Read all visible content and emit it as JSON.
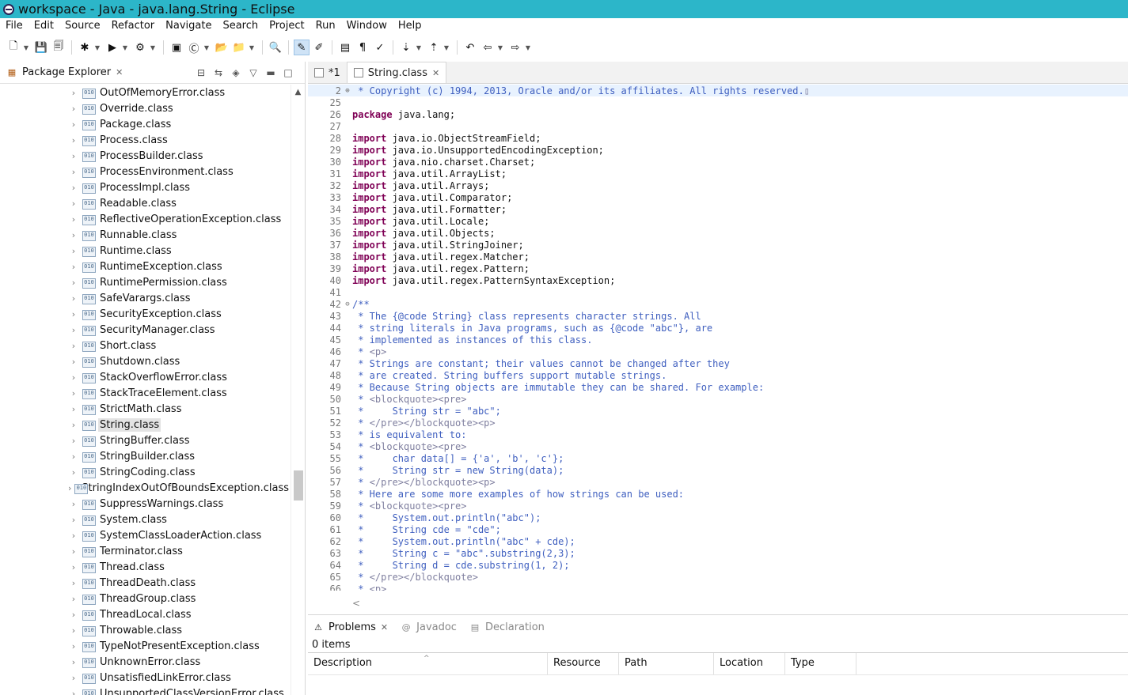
{
  "window": {
    "title": "workspace - Java - java.lang.String - Eclipse"
  },
  "menu": [
    "File",
    "Edit",
    "Source",
    "Refactor",
    "Navigate",
    "Search",
    "Project",
    "Run",
    "Window",
    "Help"
  ],
  "toolbar_icons": [
    "new-icon",
    "save-icon",
    "save-all-icon",
    "debug-icon",
    "run-icon",
    "external-tools-icon",
    "new-java-project-icon",
    "new-class-icon",
    "open-type-icon",
    "open-task-icon",
    "search-icon",
    "toggle-mark-occurrences-icon",
    "toggle-highlight-icon",
    "toggle-breadcrumb-icon",
    "show-whitespace-icon",
    "pin-icon",
    "next-annotation-icon",
    "previous-annotation-icon",
    "last-edit-location-icon",
    "back-icon",
    "forward-icon"
  ],
  "package_explorer": {
    "title": "Package Explorer",
    "selected": "String.class",
    "items": [
      "OutOfMemoryError.class",
      "Override.class",
      "Package.class",
      "Process.class",
      "ProcessBuilder.class",
      "ProcessEnvironment.class",
      "ProcessImpl.class",
      "Readable.class",
      "ReflectiveOperationException.class",
      "Runnable.class",
      "Runtime.class",
      "RuntimeException.class",
      "RuntimePermission.class",
      "SafeVarargs.class",
      "SecurityException.class",
      "SecurityManager.class",
      "Short.class",
      "Shutdown.class",
      "StackOverflowError.class",
      "StackTraceElement.class",
      "StrictMath.class",
      "String.class",
      "StringBuffer.class",
      "StringBuilder.class",
      "StringCoding.class",
      "StringIndexOutOfBoundsException.class",
      "SuppressWarnings.class",
      "System.class",
      "SystemClassLoaderAction.class",
      "Terminator.class",
      "Thread.class",
      "ThreadDeath.class",
      "ThreadGroup.class",
      "ThreadLocal.class",
      "Throwable.class",
      "TypeNotPresentException.class",
      "UnknownError.class",
      "UnsatisfiedLinkError.class",
      "UnsupportedClassVersionError.class"
    ]
  },
  "editor": {
    "tabs": [
      {
        "label": "*1"
      },
      {
        "label": "String.class"
      }
    ],
    "lines": [
      {
        "n": "2",
        "fold": "⊕",
        "segs": [
          {
            "t": " * Copyright (c) 1994, 2013, Oracle and/or its affiliates. All rights reserved.",
            "c": "c"
          },
          {
            "t": "▯",
            "c": "h"
          }
        ]
      },
      {
        "n": "25",
        "segs": []
      },
      {
        "n": "26",
        "segs": [
          {
            "t": "package",
            "c": "k"
          },
          {
            "t": " java.lang;"
          }
        ]
      },
      {
        "n": "27",
        "segs": []
      },
      {
        "n": "28",
        "segs": [
          {
            "t": "import",
            "c": "k"
          },
          {
            "t": " java.io.ObjectStreamField;"
          }
        ]
      },
      {
        "n": "29",
        "segs": [
          {
            "t": "import",
            "c": "k"
          },
          {
            "t": " java.io.UnsupportedEncodingException;"
          }
        ]
      },
      {
        "n": "30",
        "segs": [
          {
            "t": "import",
            "c": "k"
          },
          {
            "t": " java.nio.charset.Charset;"
          }
        ]
      },
      {
        "n": "31",
        "segs": [
          {
            "t": "import",
            "c": "k"
          },
          {
            "t": " java.util.ArrayList;"
          }
        ]
      },
      {
        "n": "32",
        "segs": [
          {
            "t": "import",
            "c": "k"
          },
          {
            "t": " java.util.Arrays;"
          }
        ]
      },
      {
        "n": "33",
        "segs": [
          {
            "t": "import",
            "c": "k"
          },
          {
            "t": " java.util.Comparator;"
          }
        ]
      },
      {
        "n": "34",
        "segs": [
          {
            "t": "import",
            "c": "k"
          },
          {
            "t": " java.util.Formatter;"
          }
        ]
      },
      {
        "n": "35",
        "segs": [
          {
            "t": "import",
            "c": "k"
          },
          {
            "t": " java.util.Locale;"
          }
        ]
      },
      {
        "n": "36",
        "segs": [
          {
            "t": "import",
            "c": "k"
          },
          {
            "t": " java.util.Objects;"
          }
        ]
      },
      {
        "n": "37",
        "segs": [
          {
            "t": "import",
            "c": "k"
          },
          {
            "t": " java.util.StringJoiner;"
          }
        ]
      },
      {
        "n": "38",
        "segs": [
          {
            "t": "import",
            "c": "k"
          },
          {
            "t": " java.util.regex.Matcher;"
          }
        ]
      },
      {
        "n": "39",
        "segs": [
          {
            "t": "import",
            "c": "k"
          },
          {
            "t": " java.util.regex.Pattern;"
          }
        ]
      },
      {
        "n": "40",
        "segs": [
          {
            "t": "import",
            "c": "k"
          },
          {
            "t": " java.util.regex.PatternSyntaxException;"
          }
        ]
      },
      {
        "n": "41",
        "segs": []
      },
      {
        "n": "42",
        "fold": "⊖",
        "segs": [
          {
            "t": "/**",
            "c": "c"
          }
        ]
      },
      {
        "n": "43",
        "segs": [
          {
            "t": " * The {@code String} class represents character strings. All",
            "c": "c"
          }
        ]
      },
      {
        "n": "44",
        "segs": [
          {
            "t": " * string literals in Java programs, such as {@code \"abc\"}, are",
            "c": "c"
          }
        ]
      },
      {
        "n": "45",
        "segs": [
          {
            "t": " * implemented as instances of this class.",
            "c": "c"
          }
        ]
      },
      {
        "n": "46",
        "segs": [
          {
            "t": " * ",
            "c": "c"
          },
          {
            "t": "<p>",
            "c": "h"
          }
        ]
      },
      {
        "n": "47",
        "segs": [
          {
            "t": " * Strings are constant; their values cannot be changed after they",
            "c": "c"
          }
        ]
      },
      {
        "n": "48",
        "segs": [
          {
            "t": " * are created. String buffers support mutable strings.",
            "c": "c"
          }
        ]
      },
      {
        "n": "49",
        "segs": [
          {
            "t": " * Because String objects are immutable they can be shared. For example:",
            "c": "c"
          }
        ]
      },
      {
        "n": "50",
        "segs": [
          {
            "t": " * ",
            "c": "c"
          },
          {
            "t": "<blockquote><pre>",
            "c": "h"
          }
        ]
      },
      {
        "n": "51",
        "segs": [
          {
            "t": " *     String str = \"abc\";",
            "c": "c"
          }
        ]
      },
      {
        "n": "52",
        "segs": [
          {
            "t": " * ",
            "c": "c"
          },
          {
            "t": "</pre></blockquote><p>",
            "c": "h"
          }
        ]
      },
      {
        "n": "53",
        "segs": [
          {
            "t": " * is equivalent to:",
            "c": "c"
          }
        ]
      },
      {
        "n": "54",
        "segs": [
          {
            "t": " * ",
            "c": "c"
          },
          {
            "t": "<blockquote><pre>",
            "c": "h"
          }
        ]
      },
      {
        "n": "55",
        "segs": [
          {
            "t": " *     char data[] = {'a', 'b', 'c'};",
            "c": "c"
          }
        ]
      },
      {
        "n": "56",
        "segs": [
          {
            "t": " *     String str = new String(data);",
            "c": "c"
          }
        ]
      },
      {
        "n": "57",
        "segs": [
          {
            "t": " * ",
            "c": "c"
          },
          {
            "t": "</pre></blockquote><p>",
            "c": "h"
          }
        ]
      },
      {
        "n": "58",
        "segs": [
          {
            "t": " * Here are some more examples of how strings can be used:",
            "c": "c"
          }
        ]
      },
      {
        "n": "59",
        "segs": [
          {
            "t": " * ",
            "c": "c"
          },
          {
            "t": "<blockquote><pre>",
            "c": "h"
          }
        ]
      },
      {
        "n": "60",
        "segs": [
          {
            "t": " *     System.out.println(\"abc\");",
            "c": "c"
          }
        ]
      },
      {
        "n": "61",
        "segs": [
          {
            "t": " *     String cde = \"cde\";",
            "c": "c"
          }
        ]
      },
      {
        "n": "62",
        "segs": [
          {
            "t": " *     System.out.println(\"abc\" + cde);",
            "c": "c"
          }
        ]
      },
      {
        "n": "63",
        "segs": [
          {
            "t": " *     String c = \"abc\".substring(2,3);",
            "c": "c"
          }
        ]
      },
      {
        "n": "64",
        "segs": [
          {
            "t": " *     String d = cde.substring(1, 2);",
            "c": "c"
          }
        ]
      },
      {
        "n": "65",
        "segs": [
          {
            "t": " * ",
            "c": "c"
          },
          {
            "t": "</pre></blockquote>",
            "c": "h"
          }
        ]
      },
      {
        "n": "66",
        "segs": [
          {
            "t": " * ",
            "c": "c"
          },
          {
            "t": "<p>",
            "c": "h"
          }
        ]
      }
    ],
    "h_scroll_arrow": "<"
  },
  "bottom_panel": {
    "tabs": [
      {
        "label": "Problems",
        "active": true
      },
      {
        "label": "Javadoc"
      },
      {
        "label": "Declaration"
      }
    ],
    "items_count": "0 items",
    "columns": [
      "Description",
      "Resource",
      "Path",
      "Location",
      "Type"
    ]
  }
}
